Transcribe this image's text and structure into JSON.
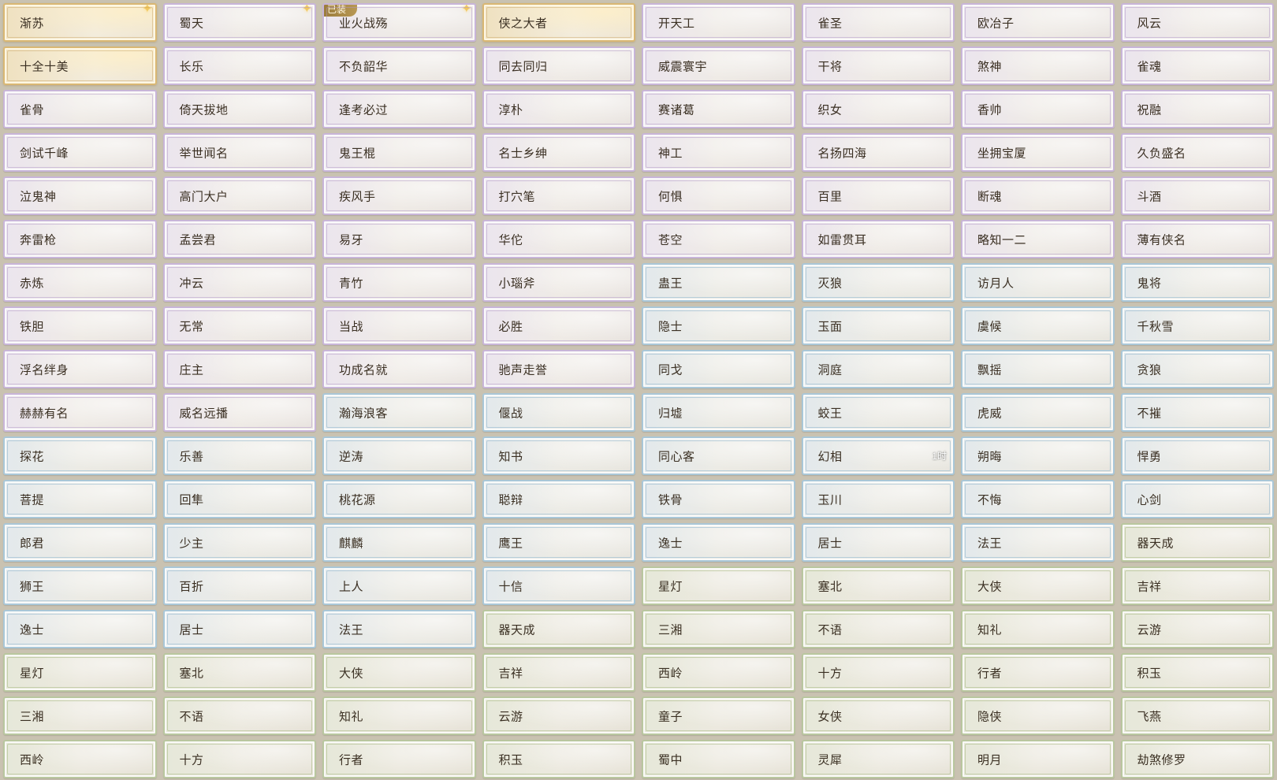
{
  "badges": {
    "equipped_label": "已装",
    "timer_label": "1时"
  },
  "tier_colors": {
    "gold": "#d9b773",
    "purple": "#c8b5d9",
    "blue": "#a9c7d8",
    "green": "#b9c79f"
  },
  "rows": [
    [
      {
        "label": "渐苏",
        "tier": "gold",
        "star": true
      },
      {
        "label": "蜀天",
        "tier": "purple",
        "star": true
      },
      {
        "label": "业火战殇",
        "tier": "purple",
        "star": true,
        "equipped": true
      },
      {
        "label": "侠之大者",
        "tier": "gold"
      },
      {
        "label": "开天工",
        "tier": "purple"
      },
      {
        "label": "雀圣",
        "tier": "purple"
      },
      {
        "label": "欧冶子",
        "tier": "purple"
      },
      {
        "label": "风云",
        "tier": "purple"
      }
    ],
    [
      {
        "label": "十全十美",
        "tier": "gold"
      },
      {
        "label": "长乐",
        "tier": "purple"
      },
      {
        "label": "不负韶华",
        "tier": "purple"
      },
      {
        "label": "同去同归",
        "tier": "purple"
      },
      {
        "label": "威震寰宇",
        "tier": "purple"
      },
      {
        "label": "干将",
        "tier": "purple"
      },
      {
        "label": "煞神",
        "tier": "purple"
      },
      {
        "label": "雀魂",
        "tier": "purple"
      }
    ],
    [
      {
        "label": "雀骨",
        "tier": "purple"
      },
      {
        "label": "倚天拔地",
        "tier": "purple"
      },
      {
        "label": "逢考必过",
        "tier": "purple"
      },
      {
        "label": "淳朴",
        "tier": "purple"
      },
      {
        "label": "赛诸葛",
        "tier": "purple"
      },
      {
        "label": "织女",
        "tier": "purple"
      },
      {
        "label": "香帅",
        "tier": "purple"
      },
      {
        "label": "祝融",
        "tier": "purple"
      }
    ],
    [
      {
        "label": "剑试千峰",
        "tier": "purple"
      },
      {
        "label": "举世闻名",
        "tier": "purple"
      },
      {
        "label": "鬼王棍",
        "tier": "purple"
      },
      {
        "label": "名士乡绅",
        "tier": "purple"
      },
      {
        "label": "神工",
        "tier": "purple"
      },
      {
        "label": "名扬四海",
        "tier": "purple"
      },
      {
        "label": "坐拥宝厦",
        "tier": "purple"
      },
      {
        "label": "久负盛名",
        "tier": "purple"
      }
    ],
    [
      {
        "label": "泣鬼神",
        "tier": "purple"
      },
      {
        "label": "高门大户",
        "tier": "purple"
      },
      {
        "label": "疾风手",
        "tier": "purple"
      },
      {
        "label": "打穴笔",
        "tier": "purple"
      },
      {
        "label": "何惧",
        "tier": "purple"
      },
      {
        "label": "百里",
        "tier": "purple"
      },
      {
        "label": "断魂",
        "tier": "purple"
      },
      {
        "label": "斗酒",
        "tier": "purple"
      }
    ],
    [
      {
        "label": "奔雷枪",
        "tier": "purple"
      },
      {
        "label": "孟尝君",
        "tier": "purple"
      },
      {
        "label": "易牙",
        "tier": "purple"
      },
      {
        "label": "华佗",
        "tier": "purple"
      },
      {
        "label": "苍空",
        "tier": "purple"
      },
      {
        "label": "如雷贯耳",
        "tier": "purple"
      },
      {
        "label": "略知一二",
        "tier": "purple"
      },
      {
        "label": "薄有侠名",
        "tier": "purple"
      }
    ],
    [
      {
        "label": "赤炼",
        "tier": "purple"
      },
      {
        "label": "冲云",
        "tier": "purple"
      },
      {
        "label": "青竹",
        "tier": "purple"
      },
      {
        "label": "小瑙斧",
        "tier": "purple"
      },
      {
        "label": "蛊王",
        "tier": "blue"
      },
      {
        "label": "灭狼",
        "tier": "blue"
      },
      {
        "label": "访月人",
        "tier": "blue"
      },
      {
        "label": "鬼将",
        "tier": "blue"
      }
    ],
    [
      {
        "label": "铁胆",
        "tier": "purple"
      },
      {
        "label": "无常",
        "tier": "purple"
      },
      {
        "label": "当战",
        "tier": "purple"
      },
      {
        "label": "必胜",
        "tier": "purple"
      },
      {
        "label": "隐士",
        "tier": "blue"
      },
      {
        "label": "玉面",
        "tier": "blue"
      },
      {
        "label": "虞候",
        "tier": "blue"
      },
      {
        "label": "千秋雪",
        "tier": "blue"
      }
    ],
    [
      {
        "label": "浮名绊身",
        "tier": "purple"
      },
      {
        "label": "庄主",
        "tier": "purple"
      },
      {
        "label": "功成名就",
        "tier": "purple"
      },
      {
        "label": "驰声走誉",
        "tier": "purple"
      },
      {
        "label": "同戈",
        "tier": "blue"
      },
      {
        "label": "洞庭",
        "tier": "blue"
      },
      {
        "label": "飘摇",
        "tier": "blue"
      },
      {
        "label": "贪狼",
        "tier": "blue"
      }
    ],
    [
      {
        "label": "赫赫有名",
        "tier": "purple"
      },
      {
        "label": "威名远播",
        "tier": "purple"
      },
      {
        "label": "瀚海浪客",
        "tier": "blue"
      },
      {
        "label": "偃战",
        "tier": "blue"
      },
      {
        "label": "归墟",
        "tier": "blue"
      },
      {
        "label": "蛟王",
        "tier": "blue"
      },
      {
        "label": "虎威",
        "tier": "blue"
      },
      {
        "label": "不摧",
        "tier": "blue"
      }
    ],
    [
      {
        "label": "探花",
        "tier": "blue"
      },
      {
        "label": "乐善",
        "tier": "blue"
      },
      {
        "label": "逆涛",
        "tier": "blue"
      },
      {
        "label": "知书",
        "tier": "blue"
      },
      {
        "label": "同心客",
        "tier": "blue"
      },
      {
        "label": "幻相",
        "tier": "blue",
        "timer": true
      },
      {
        "label": "朔晦",
        "tier": "blue"
      },
      {
        "label": "悍勇",
        "tier": "blue"
      }
    ],
    [
      {
        "label": "菩提",
        "tier": "blue"
      },
      {
        "label": "回隼",
        "tier": "blue"
      },
      {
        "label": "桃花源",
        "tier": "blue"
      },
      {
        "label": "聪辩",
        "tier": "blue"
      },
      {
        "label": "铁骨",
        "tier": "blue"
      },
      {
        "label": "玉川",
        "tier": "blue"
      },
      {
        "label": "不悔",
        "tier": "blue"
      },
      {
        "label": "心剑",
        "tier": "blue"
      }
    ],
    [
      {
        "label": "郎君",
        "tier": "blue"
      },
      {
        "label": "少主",
        "tier": "blue"
      },
      {
        "label": "麒麟",
        "tier": "blue"
      },
      {
        "label": "鹰王",
        "tier": "blue"
      },
      {
        "label": "逸士",
        "tier": "blue"
      },
      {
        "label": "居士",
        "tier": "blue"
      },
      {
        "label": "法王",
        "tier": "blue"
      },
      {
        "label": "器天成",
        "tier": "green"
      }
    ],
    [
      {
        "label": "狮王",
        "tier": "blue"
      },
      {
        "label": "百折",
        "tier": "blue"
      },
      {
        "label": "上人",
        "tier": "blue"
      },
      {
        "label": "十信",
        "tier": "blue"
      },
      {
        "label": "星灯",
        "tier": "green"
      },
      {
        "label": "塞北",
        "tier": "green"
      },
      {
        "label": "大侠",
        "tier": "green"
      },
      {
        "label": "吉祥",
        "tier": "green"
      }
    ],
    [
      {
        "label": "逸士",
        "tier": "blue"
      },
      {
        "label": "居士",
        "tier": "blue"
      },
      {
        "label": "法王",
        "tier": "blue"
      },
      {
        "label": "器天成",
        "tier": "green"
      },
      {
        "label": "三湘",
        "tier": "green"
      },
      {
        "label": "不语",
        "tier": "green"
      },
      {
        "label": "知礼",
        "tier": "green"
      },
      {
        "label": "云游",
        "tier": "green"
      }
    ],
    [
      {
        "label": "星灯",
        "tier": "green"
      },
      {
        "label": "塞北",
        "tier": "green"
      },
      {
        "label": "大侠",
        "tier": "green"
      },
      {
        "label": "吉祥",
        "tier": "green"
      },
      {
        "label": "西岭",
        "tier": "green"
      },
      {
        "label": "十方",
        "tier": "green"
      },
      {
        "label": "行者",
        "tier": "green"
      },
      {
        "label": "积玉",
        "tier": "green"
      }
    ],
    [
      {
        "label": "三湘",
        "tier": "green"
      },
      {
        "label": "不语",
        "tier": "green"
      },
      {
        "label": "知礼",
        "tier": "green"
      },
      {
        "label": "云游",
        "tier": "green"
      },
      {
        "label": "童子",
        "tier": "green"
      },
      {
        "label": "女侠",
        "tier": "green"
      },
      {
        "label": "隐侠",
        "tier": "green"
      },
      {
        "label": "飞燕",
        "tier": "green"
      }
    ],
    [
      {
        "label": "西岭",
        "tier": "green"
      },
      {
        "label": "十方",
        "tier": "green"
      },
      {
        "label": "行者",
        "tier": "green"
      },
      {
        "label": "积玉",
        "tier": "green"
      },
      {
        "label": "蜀中",
        "tier": "green"
      },
      {
        "label": "灵犀",
        "tier": "green"
      },
      {
        "label": "明月",
        "tier": "green"
      },
      {
        "label": "劫煞修罗",
        "tier": "green"
      }
    ]
  ]
}
